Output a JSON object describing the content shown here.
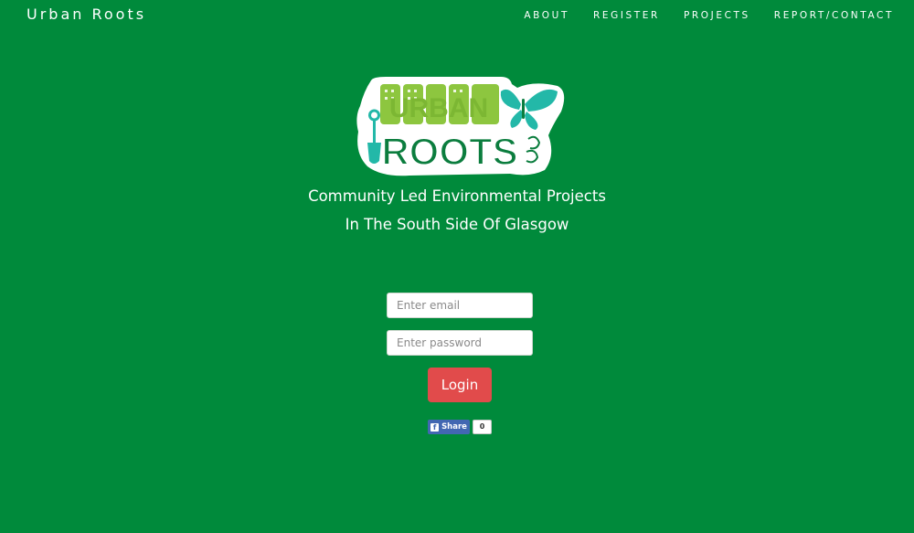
{
  "brand": "Urban Roots",
  "nav": {
    "items": [
      {
        "label": "ABOUT"
      },
      {
        "label": "REGISTER"
      },
      {
        "label": "PROJECTS"
      },
      {
        "label": "REPORT/CONTACT"
      }
    ]
  },
  "logo": {
    "line1": "URBAN",
    "line2": "ROOTS",
    "colors": {
      "green_light": "#8dc63f",
      "green_dark": "#0b7d3e",
      "teal": "#23b8a8",
      "white": "#ffffff"
    }
  },
  "hero": {
    "tagline_line1": "Community Led Environmental Projects",
    "tagline_line2": "In The South Side Of Glasgow"
  },
  "form": {
    "email": {
      "value": "",
      "placeholder": "Enter email"
    },
    "password": {
      "value": "",
      "placeholder": "Enter password"
    },
    "login_label": "Login"
  },
  "share": {
    "label": "Share",
    "count": "0"
  },
  "colors": {
    "background": "#008a3b",
    "login_button": "#e14b4b",
    "facebook": "#4267b2"
  }
}
